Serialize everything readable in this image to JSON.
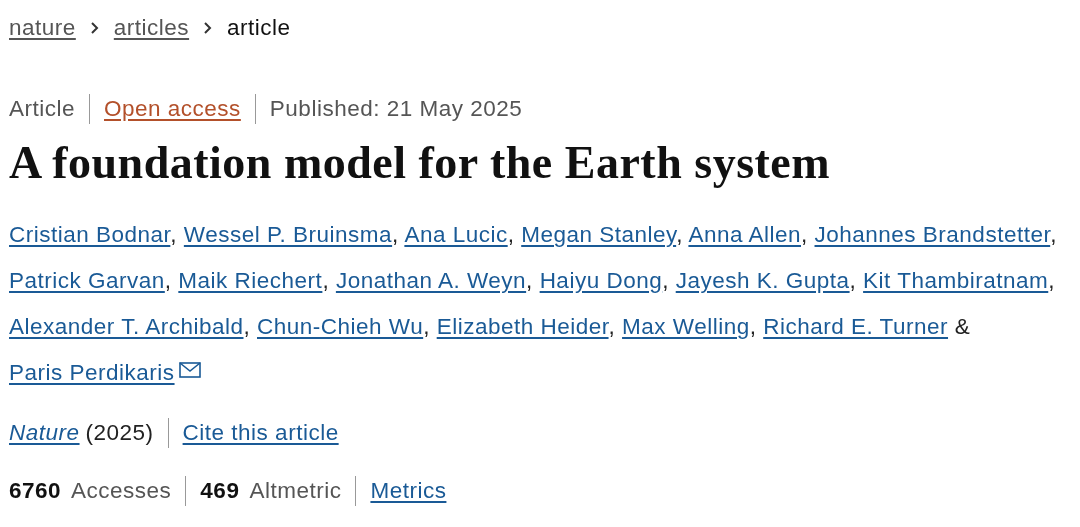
{
  "breadcrumbs": [
    {
      "label": "nature",
      "kind": "link"
    },
    {
      "label": "articles",
      "kind": "link"
    },
    {
      "label": "article",
      "kind": "current"
    }
  ],
  "meta": {
    "type": "Article",
    "access": "Open access",
    "published": "Published: 21 May 2025"
  },
  "title": "A foundation model for the Earth system",
  "authors": [
    {
      "name": "Cristian Bodnar",
      "sep": ","
    },
    {
      "name": "Wessel P. Bruinsma",
      "sep": ","
    },
    {
      "name": "Ana Lucic",
      "sep": ","
    },
    {
      "name": "Megan Stanley",
      "sep": ","
    },
    {
      "name": "Anna Allen",
      "sep": ","
    },
    {
      "name": "Johannes Brandstetter",
      "sep": ","
    },
    {
      "name": "Patrick Garvan",
      "sep": ","
    },
    {
      "name": "Maik Riechert",
      "sep": ","
    },
    {
      "name": "Jonathan A. Weyn",
      "sep": ","
    },
    {
      "name": "Haiyu Dong",
      "sep": ","
    },
    {
      "name": "Jayesh K. Gupta",
      "sep": ","
    },
    {
      "name": "Kit Thambiratnam",
      "sep": ","
    },
    {
      "name": "Alexander T. Archibald",
      "sep": ","
    },
    {
      "name": "Chun-Chieh Wu",
      "sep": ","
    },
    {
      "name": "Elizabeth Heider",
      "sep": ","
    },
    {
      "name": "Max Welling",
      "sep": ","
    },
    {
      "name": "Richard E. Turner",
      "sep": "&"
    },
    {
      "name": "Paris Perdikaris",
      "contact": true
    }
  ],
  "citation": {
    "journal": "Nature",
    "year": "(2025)",
    "cite": "Cite this article"
  },
  "metrics": [
    {
      "count": "6760",
      "unit": "Accesses"
    },
    {
      "count": "469",
      "unit": "Altmetric"
    }
  ],
  "metrics_link": "Metrics"
}
